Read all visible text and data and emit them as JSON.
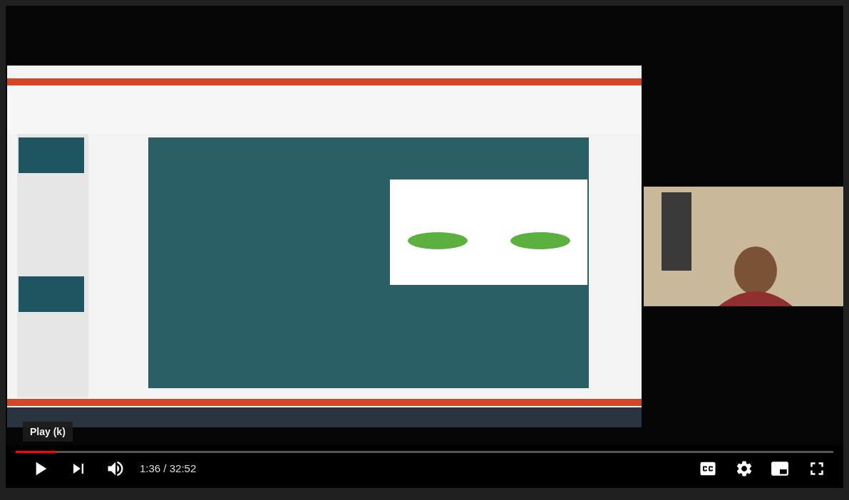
{
  "tooltip": {
    "text": "Play (k)"
  },
  "progress": {
    "level": 0.049
  },
  "controls": {
    "time": "1:36 / 32:52"
  }
}
